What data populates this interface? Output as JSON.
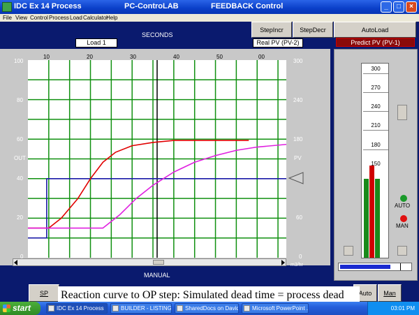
{
  "window": {
    "title": "IDC Ex 14 Process",
    "center_title": "PC-ControLAB",
    "mode_title": "FEEDBACK Control"
  },
  "menu": [
    "File",
    "View",
    "Control",
    "Process",
    "Load",
    "Calculator",
    "Help"
  ],
  "toolbar": {
    "step_incr": "StepIncr",
    "step_decr": "StepDecr",
    "auto_load": "AutoLoad"
  },
  "header": {
    "seconds": "SECONDS",
    "load": "Load 1",
    "real_pv": "Real PV (PV-2)",
    "predict_pv": "Predict PV (PV-1)"
  },
  "axes": {
    "left_label": "OUT",
    "right_label": "PV",
    "bottom_label": "MANUAL",
    "right_units": "m3/hr",
    "left_ticks": [
      "100",
      "80",
      "60",
      "40",
      "20",
      "0"
    ],
    "right_ticks": [
      "300",
      "240",
      "180",
      "120",
      "60",
      "0"
    ],
    "top_ticks": [
      "10",
      "20",
      "30",
      "40",
      "50",
      "00"
    ]
  },
  "gauge": {
    "ticks": [
      "300",
      "270",
      "240",
      "210",
      "180",
      "150"
    ]
  },
  "status": {
    "auto": "AUTO",
    "man": "MAN"
  },
  "bottom_buttons": {
    "sp": "SP",
    "auto": "Auto",
    "man": "Man"
  },
  "caption": "Reaction curve to OP step: Simulated dead time = process dead time",
  "taskbar": {
    "start": "start",
    "tasks": [
      "IDC Ex 14 Process",
      "BUILDER - LISTING: ...",
      "SharedDocs on David'...",
      "Microsoft PowerPoint ..."
    ],
    "clock": "03:01 PM"
  },
  "colors": {
    "background": "#0a1a6e",
    "output_trend": "#1a1aa8",
    "real_pv_trend": "#e00000",
    "predict_pv_trend": "#e020e0",
    "grid": "#109010"
  },
  "chart_data": {
    "type": "line",
    "x_ticks": [
      "10",
      "20",
      "30",
      "40",
      "50",
      "00"
    ],
    "left_axis": {
      "label": "OUT",
      "range": [
        0,
        100
      ]
    },
    "right_axis": {
      "label": "PV",
      "range": [
        0,
        300
      ],
      "units": "m3/hr"
    },
    "series": [
      {
        "name": "",
        "axis": "left",
        "color": "#1a1aa8",
        "points": [
          [
            5,
            10
          ],
          [
            9.5,
            10
          ],
          [
            9.5,
            40
          ],
          [
            67,
            40
          ]
        ]
      },
      {
        "name": "Real PV (PV-2)",
        "axis": "right",
        "color": "#e00000",
        "points": [
          [
            5,
            45
          ],
          [
            10,
            45
          ],
          [
            13,
            60
          ],
          [
            17,
            90
          ],
          [
            20,
            120
          ],
          [
            23,
            145
          ],
          [
            26,
            160
          ],
          [
            30,
            170
          ],
          [
            35,
            175
          ],
          [
            40,
            178
          ],
          [
            50,
            178
          ],
          [
            58,
            178
          ]
        ]
      },
      {
        "name": "Predict PV (PV-1)",
        "axis": "right",
        "color": "#e020e0",
        "points": [
          [
            5,
            45
          ],
          [
            23,
            45
          ],
          [
            27,
            65
          ],
          [
            31,
            90
          ],
          [
            35,
            110
          ],
          [
            40,
            130
          ],
          [
            45,
            145
          ],
          [
            50,
            155
          ],
          [
            55,
            163
          ],
          [
            60,
            168
          ],
          [
            67,
            172
          ]
        ]
      }
    ]
  }
}
